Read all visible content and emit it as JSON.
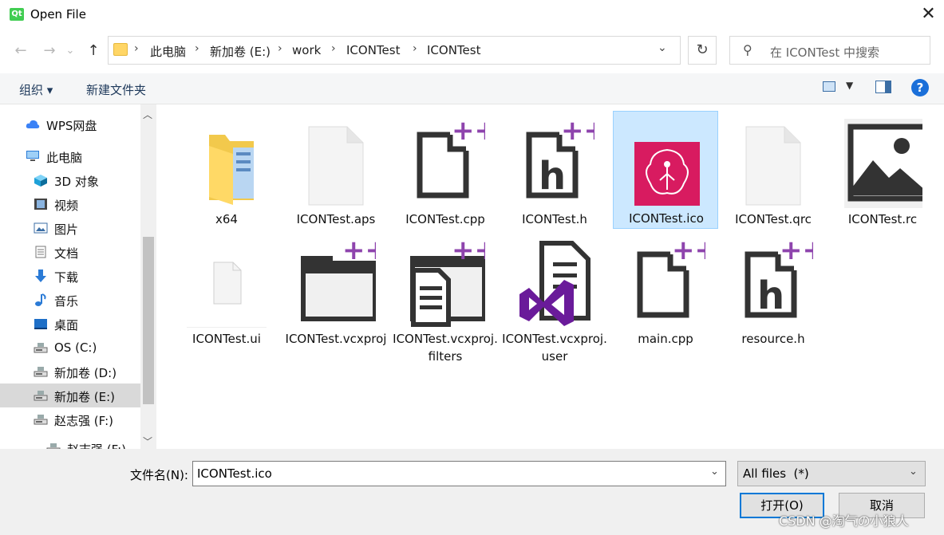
{
  "window": {
    "title": "Open File",
    "app_badge": "Qt",
    "close_glyph": "✕"
  },
  "nav": {
    "back_glyph": "←",
    "forward_glyph": "→",
    "recent_glyph": "⌄",
    "up_glyph": "↑",
    "breadcrumbs": [
      "此电脑",
      "新加卷 (E:)",
      "work",
      "ICONTest",
      "ICONTest"
    ],
    "separator": "›",
    "refresh_glyph": "↻",
    "search_placeholder": "在 ICONTest 中搜索",
    "search_icon_glyph": "⚲"
  },
  "toolbar": {
    "organize": "组织 ▾",
    "new_folder": "新建文件夹",
    "help": "?"
  },
  "sidebar": {
    "items": [
      {
        "label": "WPS网盘",
        "icon": "cloud-icon",
        "color": "#3b82f6"
      },
      {
        "label": "此电脑",
        "icon": "computer-icon",
        "color": "#2b7bd6"
      },
      {
        "label": "3D 对象",
        "icon": "cube-icon",
        "color": "#1fa1d8"
      },
      {
        "label": "视频",
        "icon": "film-icon",
        "color": "#444444"
      },
      {
        "label": "图片",
        "icon": "picture-icon",
        "color": "#3b6ea5"
      },
      {
        "label": "文档",
        "icon": "document-icon",
        "color": "#777777"
      },
      {
        "label": "下载",
        "icon": "download-icon",
        "color": "#2b7bd6"
      },
      {
        "label": "音乐",
        "icon": "music-icon",
        "color": "#2b7bd6"
      },
      {
        "label": "桌面",
        "icon": "desktop-icon",
        "color": "#1e6fc7"
      },
      {
        "label": "OS (C:)",
        "icon": "drive-icon",
        "color": "#666666"
      },
      {
        "label": "新加卷 (D:)",
        "icon": "drive-icon",
        "color": "#666666"
      },
      {
        "label": "新加卷 (E:)",
        "icon": "drive-icon",
        "color": "#666666"
      },
      {
        "label": "赵志强 (F:)",
        "icon": "drive-icon",
        "color": "#666666"
      },
      {
        "label": "赵志强 (F:)",
        "icon": "drive-icon",
        "color": "#666666"
      }
    ],
    "selected_index": 11
  },
  "files": [
    {
      "name": "x64",
      "type": "folder"
    },
    {
      "name": "ICONTest.aps",
      "type": "blank"
    },
    {
      "name": "ICONTest.cpp",
      "type": "cpp"
    },
    {
      "name": "ICONTest.h",
      "type": "h"
    },
    {
      "name": "ICONTest.ico",
      "type": "ico"
    },
    {
      "name": "ICONTest.qrc",
      "type": "blank"
    },
    {
      "name": "ICONTest.rc",
      "type": "image"
    },
    {
      "name": "ICONTest.ui",
      "type": "ui"
    },
    {
      "name": "ICONTest.vcxproj",
      "type": "vcx-folder"
    },
    {
      "name": "ICONTest.vcxproj.filters",
      "type": "vcx-filters"
    },
    {
      "name": "ICONTest.vcxproj.user",
      "type": "vs"
    },
    {
      "name": "main.cpp",
      "type": "cpp"
    },
    {
      "name": "resource.h",
      "type": "h"
    }
  ],
  "selected_file": "ICONTest.ico",
  "bottom": {
    "filename_label": "文件名(N):",
    "filename_value": "ICONTest.ico",
    "filter_value": "All files  (*)",
    "dropdown_glyph": "⌄",
    "open_label": "打开(O)",
    "cancel_label": "取消"
  },
  "watermark": "CSDN @淘气の小狼人",
  "colors": {
    "selection": "#cce8ff",
    "accent": "#0078d7",
    "plusplus": "#8e44ad",
    "ico_bg": "#d81b60"
  }
}
